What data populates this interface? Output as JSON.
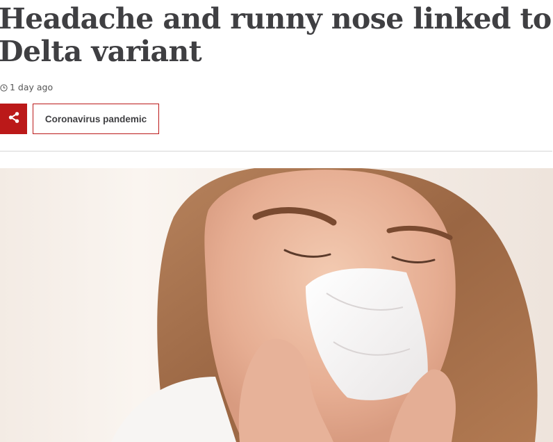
{
  "article": {
    "headline": "Headache and runny nose linked to Delta variant",
    "timestamp": "1 day ago",
    "topic_tag": "Coronavirus pandemic"
  },
  "icons": {
    "timestamp": "clock-icon",
    "share": "share-icon"
  },
  "colors": {
    "accent": "#bb1919",
    "headline_text": "#3f3f42",
    "divider": "#d6d6d6"
  }
}
